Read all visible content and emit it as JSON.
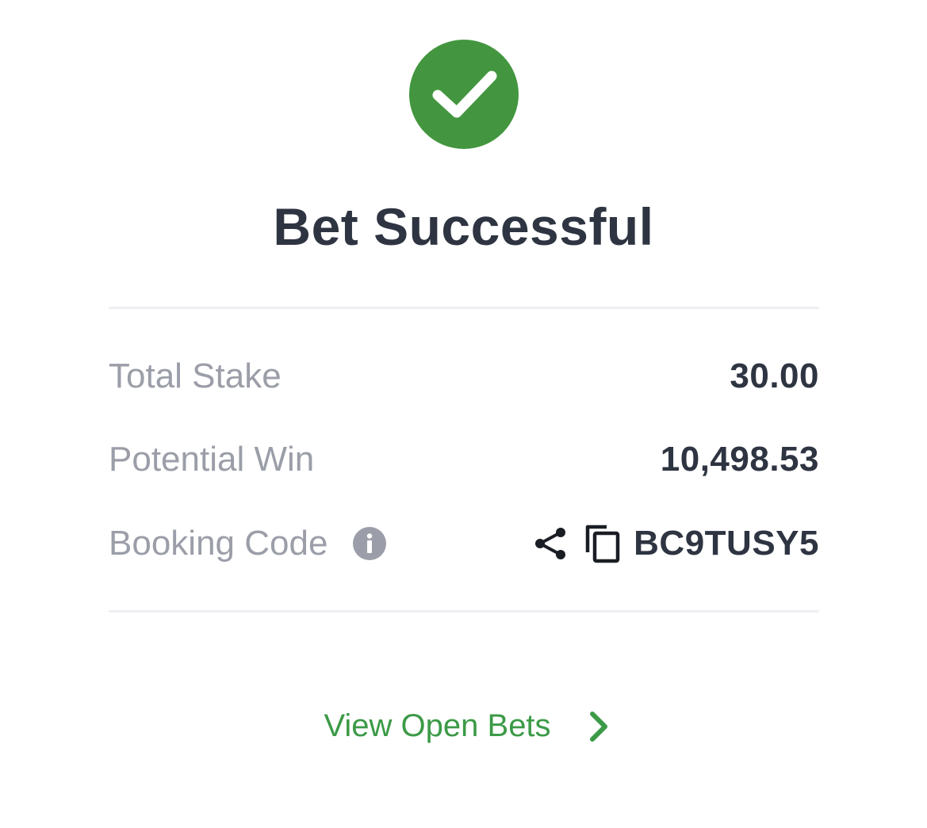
{
  "colors": {
    "success_green": "#43963f",
    "link_green": "#3c9a47",
    "title": "#2e3441",
    "label_gray": "#9b9ea8"
  },
  "status": {
    "icon": "checkmark-icon",
    "title": "Bet Successful"
  },
  "summary": {
    "stake_label": "Total Stake",
    "stake_value": "30.00",
    "win_label": "Potential Win",
    "win_value": "10,498.53",
    "booking_label": "Booking Code",
    "booking_info_icon": "info-icon",
    "booking_share_icon": "share-icon",
    "booking_copy_icon": "copy-icon",
    "booking_code": "BC9TUSY5"
  },
  "footer": {
    "view_open_bets_label": "View Open Bets",
    "chevron_icon": "chevron-right-icon"
  }
}
